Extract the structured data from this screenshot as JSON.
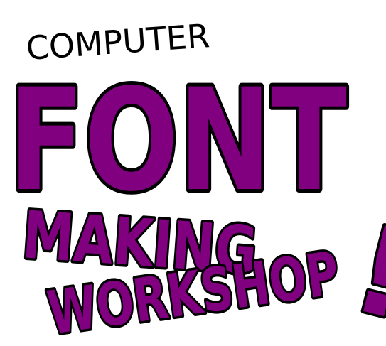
{
  "logo": {
    "line_1": "COMPUTER",
    "line_2": "FONT",
    "line_3": "MAKING",
    "line_4": "WORKSHOP",
    "exclamation": "!"
  },
  "colors": {
    "background": "#ffffff",
    "letter_fill": "#800080",
    "outline": "#000000",
    "line_1_text": "#000000"
  }
}
